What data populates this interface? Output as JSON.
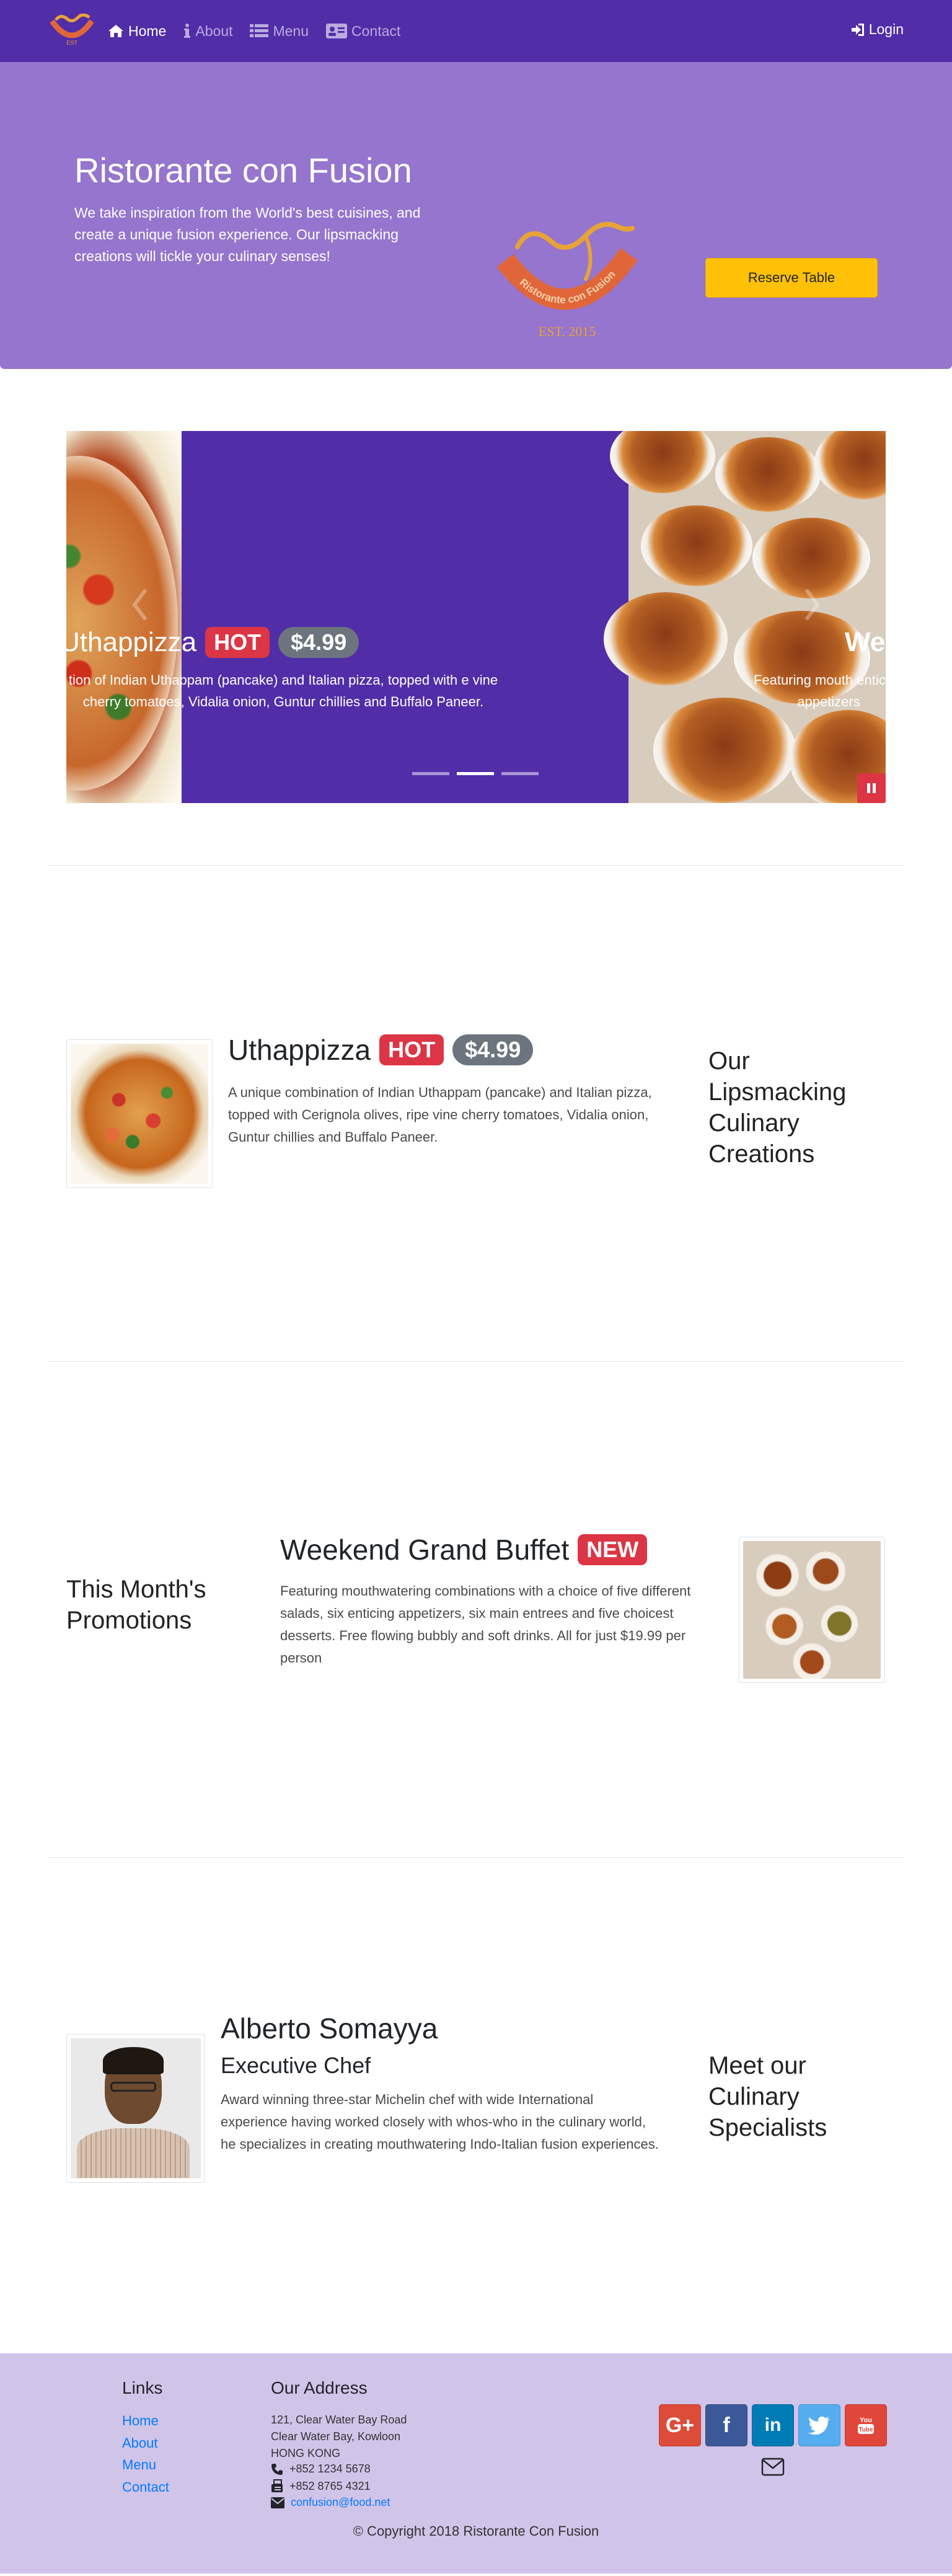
{
  "nav": {
    "items": [
      {
        "label": "Home",
        "icon": "home-icon",
        "active": true
      },
      {
        "label": "About",
        "icon": "info-icon",
        "active": false
      },
      {
        "label": "Menu",
        "icon": "list-icon",
        "active": false
      },
      {
        "label": "Contact",
        "icon": "address-card-icon",
        "active": false
      }
    ],
    "login": "Login"
  },
  "jumbotron": {
    "title": "Ristorante con Fusion",
    "text": "We take inspiration from the World's best cuisines, and create a unique fusion experience. Our lipsmacking creations will tickle your culinary senses!",
    "logo_text": "Ristorante con Fusion",
    "logo_est": "EST. 2015",
    "reserve": "Reserve Table"
  },
  "carousel": {
    "left_title": "Uthappizza",
    "left_badge": "HOT",
    "left_price": "$4.99",
    "left_text": "tion of Indian Uthappam (pancake) and Italian pizza, topped with e vine cherry tomatoes, Vidalia onion, Guntur chillies and Buffalo Paneer.",
    "right_title": "We",
    "right_text": "Featuring mouth enticing appetizers",
    "indicators": 3,
    "active_indicator": 2
  },
  "dish": {
    "name": "Uthappizza",
    "badge": "HOT",
    "price": "$4.99",
    "description": "A unique combination of Indian Uthappam (pancake) and Italian pizza, topped with Cerignola olives, ripe vine cherry tomatoes, Vidalia onion, Guntur chillies and Buffalo Paneer.",
    "side_heading": "Our Lipsmacking Culinary Creations"
  },
  "promotion": {
    "side_heading": "This Month's Promotions",
    "name": "Weekend Grand Buffet",
    "badge": "NEW",
    "description": "Featuring mouthwatering combinations with a choice of five different salads, six enticing appetizers, six main entrees and five choicest desserts. Free flowing bubbly and soft drinks. All for just $19.99 per person"
  },
  "leader": {
    "name": "Alberto Somayya",
    "role": "Executive Chef",
    "description": "Award winning three-star Michelin chef with wide International experience having worked closely with whos-who in the culinary world, he specializes in creating mouthwatering Indo-Italian fusion experiences.",
    "side_heading": "Meet our Culinary Specialists"
  },
  "footer": {
    "links_heading": "Links",
    "links": [
      "Home",
      "About",
      "Menu",
      "Contact"
    ],
    "address_heading": "Our Address",
    "address_line1": "121, Clear Water Bay Road",
    "address_line2": "Clear Water Bay, Kowloon",
    "address_line3": "HONG KONG",
    "phone": "+852 1234 5678",
    "fax": "+852 8765 4321",
    "email": "confusion@food.net",
    "social": [
      "google-plus-icon",
      "facebook-icon",
      "linkedin-icon",
      "twitter-icon",
      "youtube-icon"
    ],
    "copyright": "© Copyright 2018 Ristorante Con Fusion"
  },
  "colors": {
    "navbar": "#512da8",
    "jumbotron": "#9575cd",
    "footer": "#d1c4e9",
    "reserve": "#ffc107",
    "badge_hot": "#dc3545",
    "badge_price": "#6c757d"
  }
}
